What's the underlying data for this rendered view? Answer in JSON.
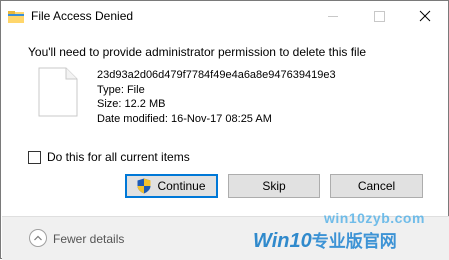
{
  "window": {
    "title": "File Access Denied"
  },
  "message": "You'll need to provide administrator permission to delete this file",
  "file": {
    "name": "23d93a2d06d479f7784f49e4a6a8e947639419e3",
    "type": "Type: File",
    "size": "Size: 12.2 MB",
    "date_modified": "Date modified: 16-Nov-17 08:25 AM",
    "icon": "blank-file-icon"
  },
  "checkbox": {
    "label": "Do this for all current items",
    "checked": false
  },
  "buttons": {
    "continue": "Continue",
    "skip": "Skip",
    "cancel": "Cancel"
  },
  "footer": {
    "toggle_label": "Fewer details"
  },
  "watermark": {
    "url": "win10zyb.com",
    "logo_latin": "Win10",
    "logo_cn": "专业版官网"
  },
  "colors": {
    "accent": "#0078d7",
    "button_bg": "#e1e1e1",
    "footer_bg": "#f0f0f0",
    "watermark": "#1c7fc9"
  }
}
